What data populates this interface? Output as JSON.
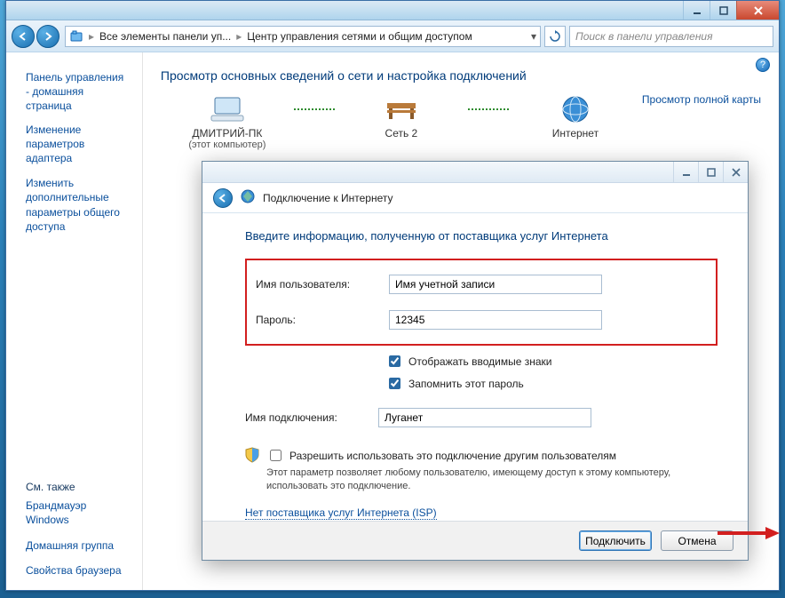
{
  "explorer": {
    "breadcrumb1": "Все элементы панели уп...",
    "breadcrumb2": "Центр управления сетями и общим доступом",
    "search_placeholder": "Поиск в панели управления"
  },
  "sidebar": {
    "home": "Панель управления - домашняя страница",
    "link1": "Изменение параметров адаптера",
    "link2": "Изменить дополнительные параметры общего доступа",
    "see_also": "См. также",
    "sa1": "Брандмауэр Windows",
    "sa2": "Домашняя группа",
    "sa3": "Свойства браузера"
  },
  "main": {
    "heading": "Просмотр основных сведений о сети и настройка подключений",
    "map_link": "Просмотр полной карты",
    "node1": "ДМИТРИЙ-ПК",
    "node1_sub": "(этот компьютер)",
    "node2": "Сеть 2",
    "node3": "Интернет"
  },
  "dialog": {
    "title": "Подключение к Интернету",
    "heading": "Введите информацию, полученную от поставщика услуг Интернета",
    "user_label": "Имя пользователя:",
    "user_value": "Имя учетной записи",
    "pass_label": "Пароль:",
    "pass_value": "12345",
    "chk_show": "Отображать вводимые знаки",
    "chk_remember": "Запомнить этот пароль",
    "conn_label": "Имя подключения:",
    "conn_value": "Луганет",
    "allow_label": "Разрешить использовать это подключение другим пользователям",
    "allow_desc": "Этот параметр позволяет любому пользователю, имеющему доступ к этому компьютеру, использовать это подключение.",
    "isp_link": "Нет поставщика услуг Интернета (ISP)",
    "btn_connect": "Подключить",
    "btn_cancel": "Отмена"
  }
}
